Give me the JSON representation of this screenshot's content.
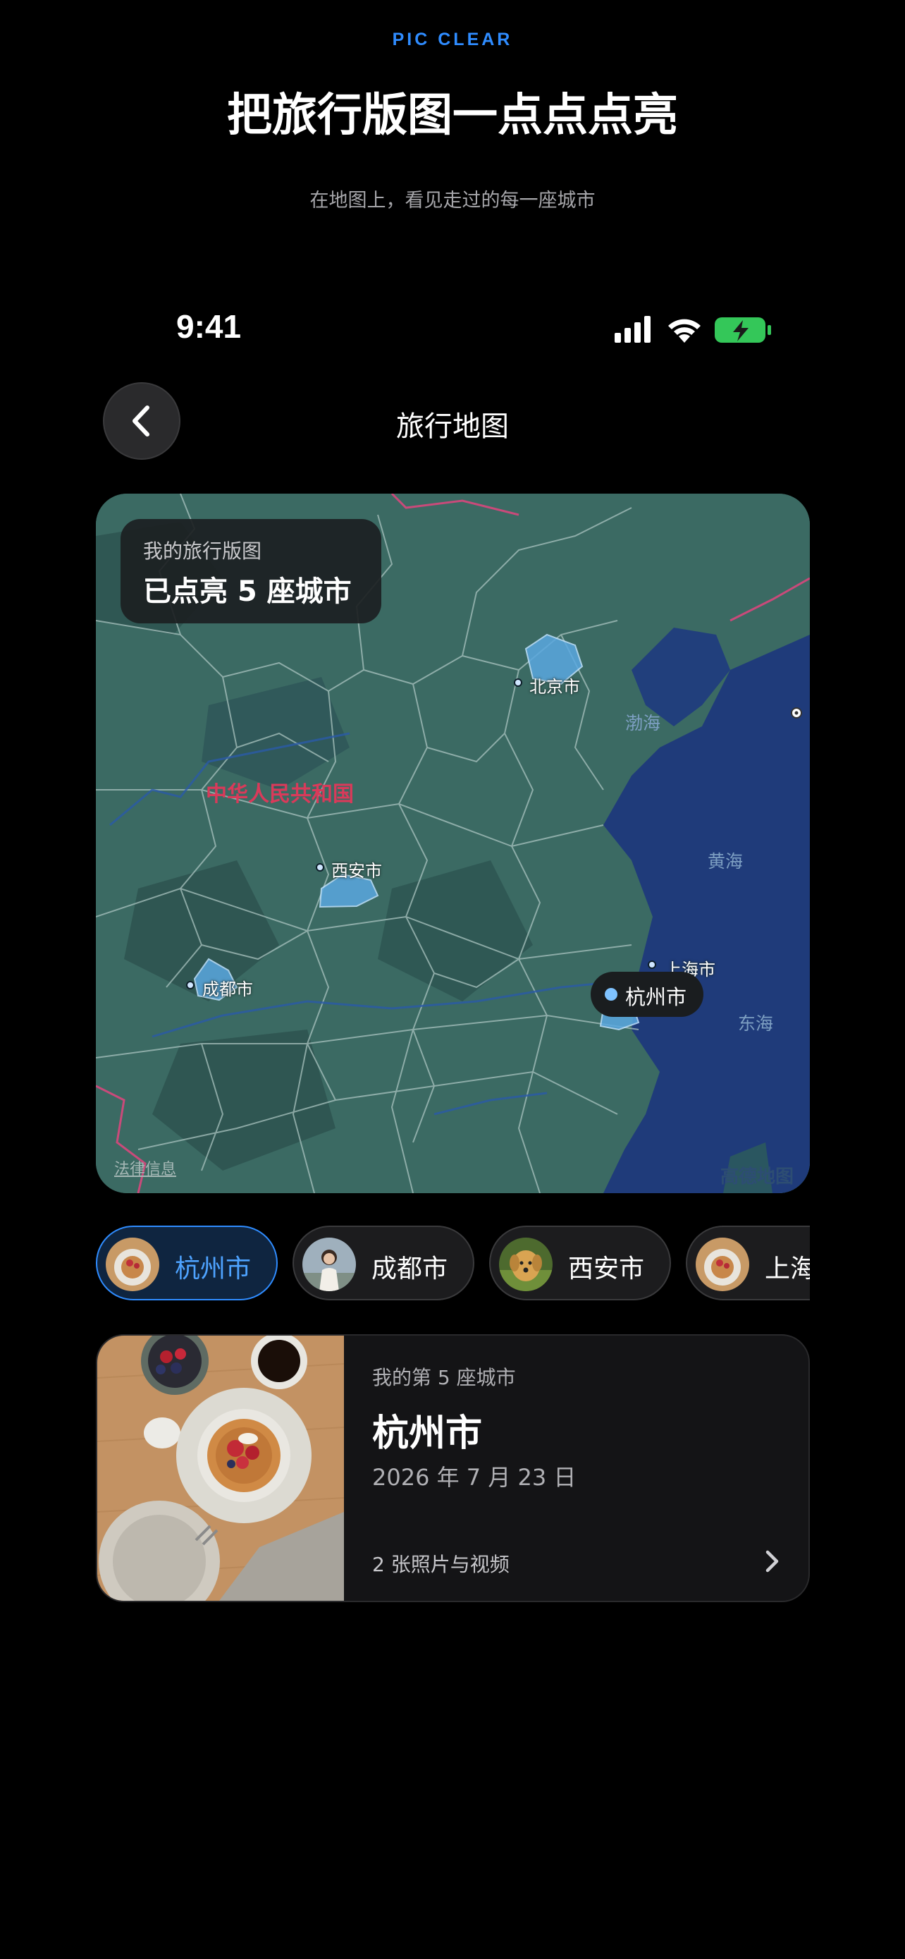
{
  "header": {
    "brand": "PIC CLEAR",
    "headline": "把旅行版图一点点点亮",
    "subline": "在地图上，看见走过的每一座城市"
  },
  "status_bar": {
    "time": "9:41",
    "icons": [
      "signal-icon",
      "wifi-icon",
      "battery-charging-icon"
    ]
  },
  "nav": {
    "back_icon": "chevron-left-icon",
    "title": "旅行地图"
  },
  "map": {
    "badge_label": "我的旅行版图",
    "badge_value": "已点亮 5 座城市",
    "country_label": "中华人民共和国",
    "cities": [
      "北京市",
      "西安市",
      "成都市",
      "上海市",
      "杭州市"
    ],
    "seas": [
      "渤海",
      "黄海",
      "东海"
    ],
    "selected_city": "杭州市",
    "legal_link": "法律信息",
    "provider_logo": "高德地图",
    "colors": {
      "land": "#3a6660",
      "sea": "#1e3a78",
      "lit_city": "#5aa8e0",
      "border_line": "#c94a7a"
    }
  },
  "chips": [
    {
      "label": "杭州市",
      "active": true,
      "avatar": "pancake-photo"
    },
    {
      "label": "成都市",
      "active": false,
      "avatar": "person-photo"
    },
    {
      "label": "西安市",
      "active": false,
      "avatar": "dog-photo"
    },
    {
      "label": "上海市",
      "active": false,
      "avatar": "pancake-photo"
    }
  ],
  "card": {
    "subtitle": "我的第 5 座城市",
    "title": "杭州市",
    "date": "2026 年 7 月 23 日",
    "media_count": "2 张照片与视频",
    "chevron_icon": "chevron-right-icon"
  },
  "accent_color": "#2f8cff"
}
